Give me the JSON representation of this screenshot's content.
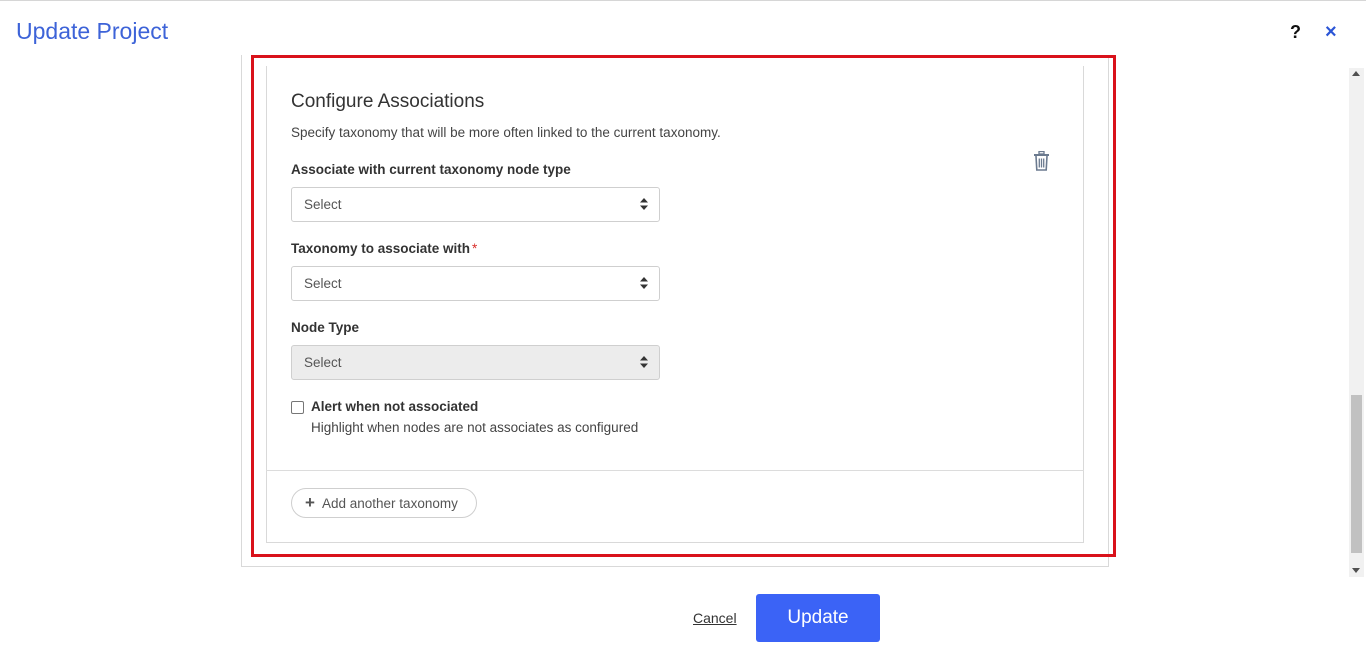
{
  "modal": {
    "title": "Update Project",
    "help_label": "?",
    "close_label": "×"
  },
  "section": {
    "title": "Configure Associations",
    "description": "Specify taxonomy that will be more often linked to the current taxonomy."
  },
  "fields": {
    "node_type_current": {
      "label": "Associate with current taxonomy node type",
      "value": "Select"
    },
    "taxonomy": {
      "label": "Taxonomy to associate with",
      "required_mark": "*",
      "value": "Select"
    },
    "node_type": {
      "label": "Node Type",
      "value": "Select"
    }
  },
  "alert": {
    "label": "Alert when not associated",
    "help": "Highlight when nodes are not associates as configured",
    "checked": false
  },
  "add_button": {
    "plus": "+",
    "label": "Add another taxonomy"
  },
  "footer": {
    "cancel_label": "Cancel",
    "update_label": "Update"
  },
  "colors": {
    "accent": "#3b63f6",
    "title": "#3d63d8",
    "highlight_frame": "#d9121b",
    "required": "#d9302c"
  },
  "icons": [
    "help-icon",
    "close-icon",
    "trash-icon",
    "select-arrows-icon",
    "plus-icon"
  ]
}
